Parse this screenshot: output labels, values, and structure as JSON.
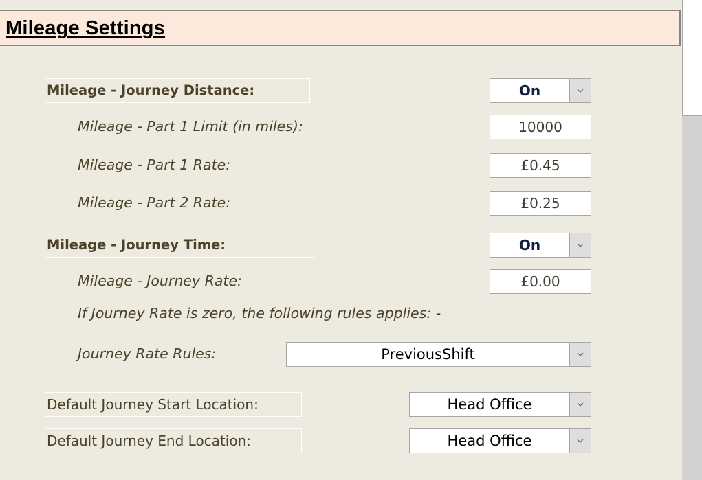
{
  "page": {
    "title": "Mileage Settings"
  },
  "journey_distance": {
    "label": "Mileage - Journey Distance:",
    "value": "On",
    "part1_limit": {
      "label": "Mileage - Part 1 Limit (in miles):",
      "value": "10000"
    },
    "part1_rate": {
      "label": "Mileage - Part 1 Rate:",
      "value": "£0.45"
    },
    "part2_rate": {
      "label": "Mileage - Part 2 Rate:",
      "value": "£0.25"
    }
  },
  "journey_time": {
    "label": "Mileage - Journey Time:",
    "value": "On",
    "journey_rate": {
      "label": "Mileage - Journey Rate:",
      "value": "£0.00"
    },
    "zero_rate_note": "If Journey Rate is zero, the following rules applies: -",
    "rules": {
      "label": "Journey Rate Rules:",
      "value": "PreviousShift"
    }
  },
  "locations": {
    "start": {
      "label": "Default Journey Start Location:",
      "value": "Head Office"
    },
    "end": {
      "label": "Default Journey End Location:",
      "value": "Head Office"
    }
  },
  "icons": {
    "dropdown": "chevron-down-icon"
  }
}
